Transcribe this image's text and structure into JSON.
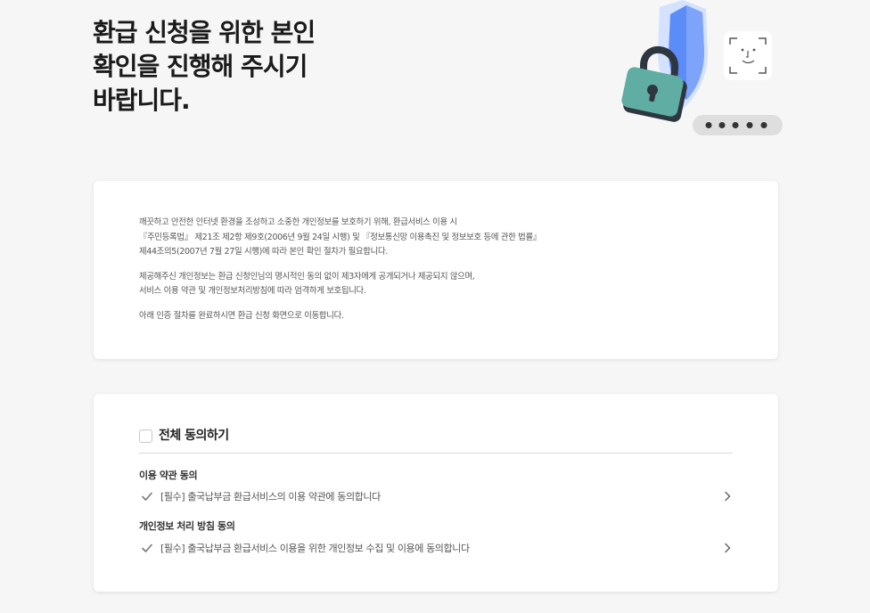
{
  "header": {
    "title_lines": [
      "환급 신청을 위한 본인",
      "확인을 진행해 주시기",
      "바랍니다."
    ]
  },
  "illustration": {
    "icons": [
      "shield-icon",
      "lock-icon",
      "face-scan-icon",
      "password-dots-icon"
    ],
    "colors": {
      "shield_light": "#d4e1ff",
      "shield_main": "#5b8cf7",
      "lock_body": "#5fada3",
      "lock_dark": "#2e3640",
      "pill": "#dedede"
    }
  },
  "notice": {
    "para1": [
      "깨끗하고 안전한 인터넷 환경을 조성하고 소중한 개인정보를 보호하기 위해, 환급서비스 이용 시",
      "『주민등록법』 제21조 제2항 제9호(2006년 9월 24일 시행) 및 『정보통신망 이용촉진 및 정보보호 등에 관한 법률』",
      "제44조의5(2007년 7월 27일 시행)에 따라 본인 확인 절차가 필요합니다."
    ],
    "para2": [
      "제공해주신 개인정보는 환급 신청인님의 명시적인 동의 없이 제3자에게 공개되거나 제공되지 않으며,",
      "서비스 이용 약관 및 개인정보처리방침에 따라 엄격하게 보호됩니다."
    ],
    "para3": "아래 인증 절차를 완료하시면 환급 신청 화면으로 이동합니다."
  },
  "agreement": {
    "all_label": "전체 동의하기",
    "sections": [
      {
        "title": "이용 약관 동의",
        "item": "[필수] 출국납부금 환급서비스의 이용 약관에 동의합니다"
      },
      {
        "title": "개인정보 처리 방침 동의",
        "item": "[필수] 출국납부금 환급서비스 이용을 위한 개인정보 수집 및 이용에 동의합니다"
      }
    ]
  }
}
